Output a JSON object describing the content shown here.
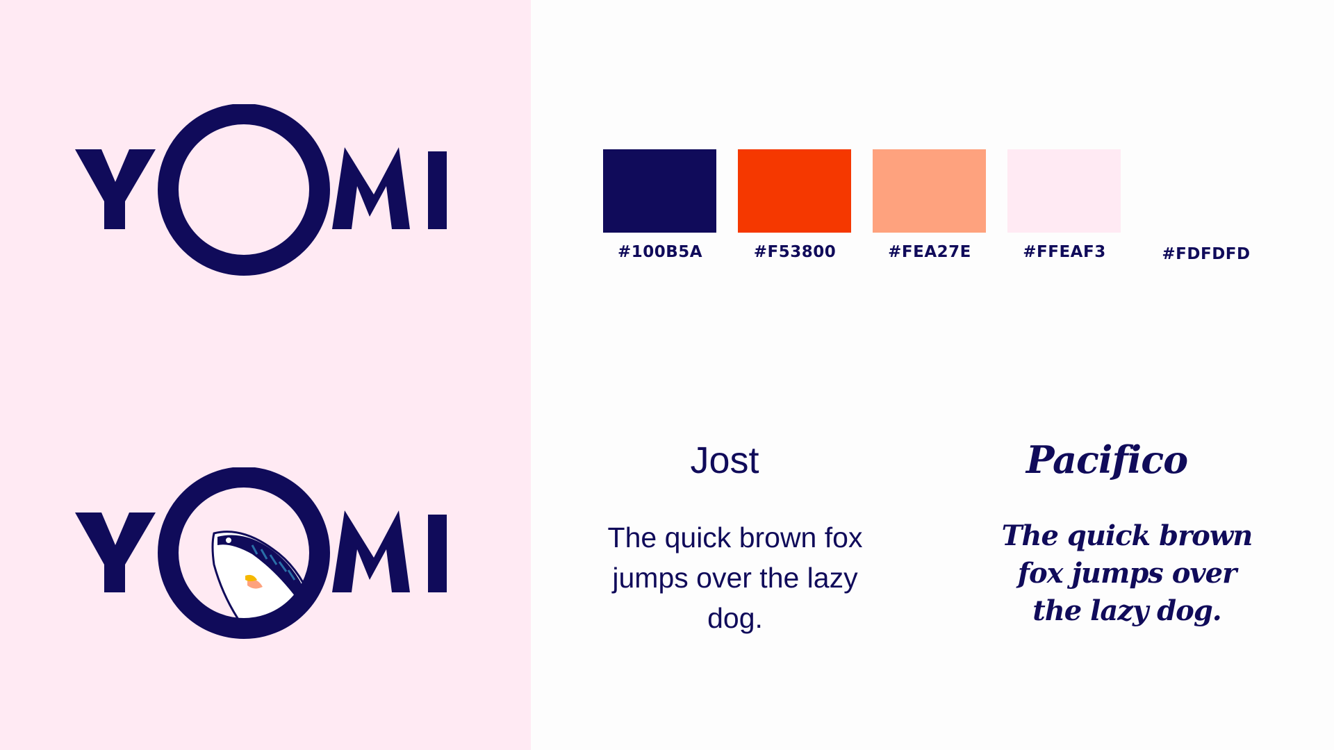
{
  "brand": {
    "wordmark": "YOMI"
  },
  "palette": {
    "colors": [
      {
        "hex_label": "#100B5A",
        "value": "#100B5A"
      },
      {
        "hex_label": "#F53800",
        "value": "#F53800"
      },
      {
        "hex_label": "#FEA27E",
        "value": "#FEA27E"
      },
      {
        "hex_label": "#FFEAF3",
        "value": "#FFEAF3"
      },
      {
        "hex_label": "#FDFDFD",
        "value": "#FDFDFD"
      }
    ]
  },
  "typography": {
    "primary": {
      "name": "Jost",
      "sample": "The quick brown fox jumps over the lazy dog."
    },
    "secondary": {
      "name": "Pacifico",
      "sample": "The quick brown fox jumps over the lazy dog."
    }
  },
  "logo_variants": [
    {
      "variant": "plain",
      "icon": "none"
    },
    {
      "variant": "with-fish",
      "icon": "fish-icon"
    }
  ]
}
